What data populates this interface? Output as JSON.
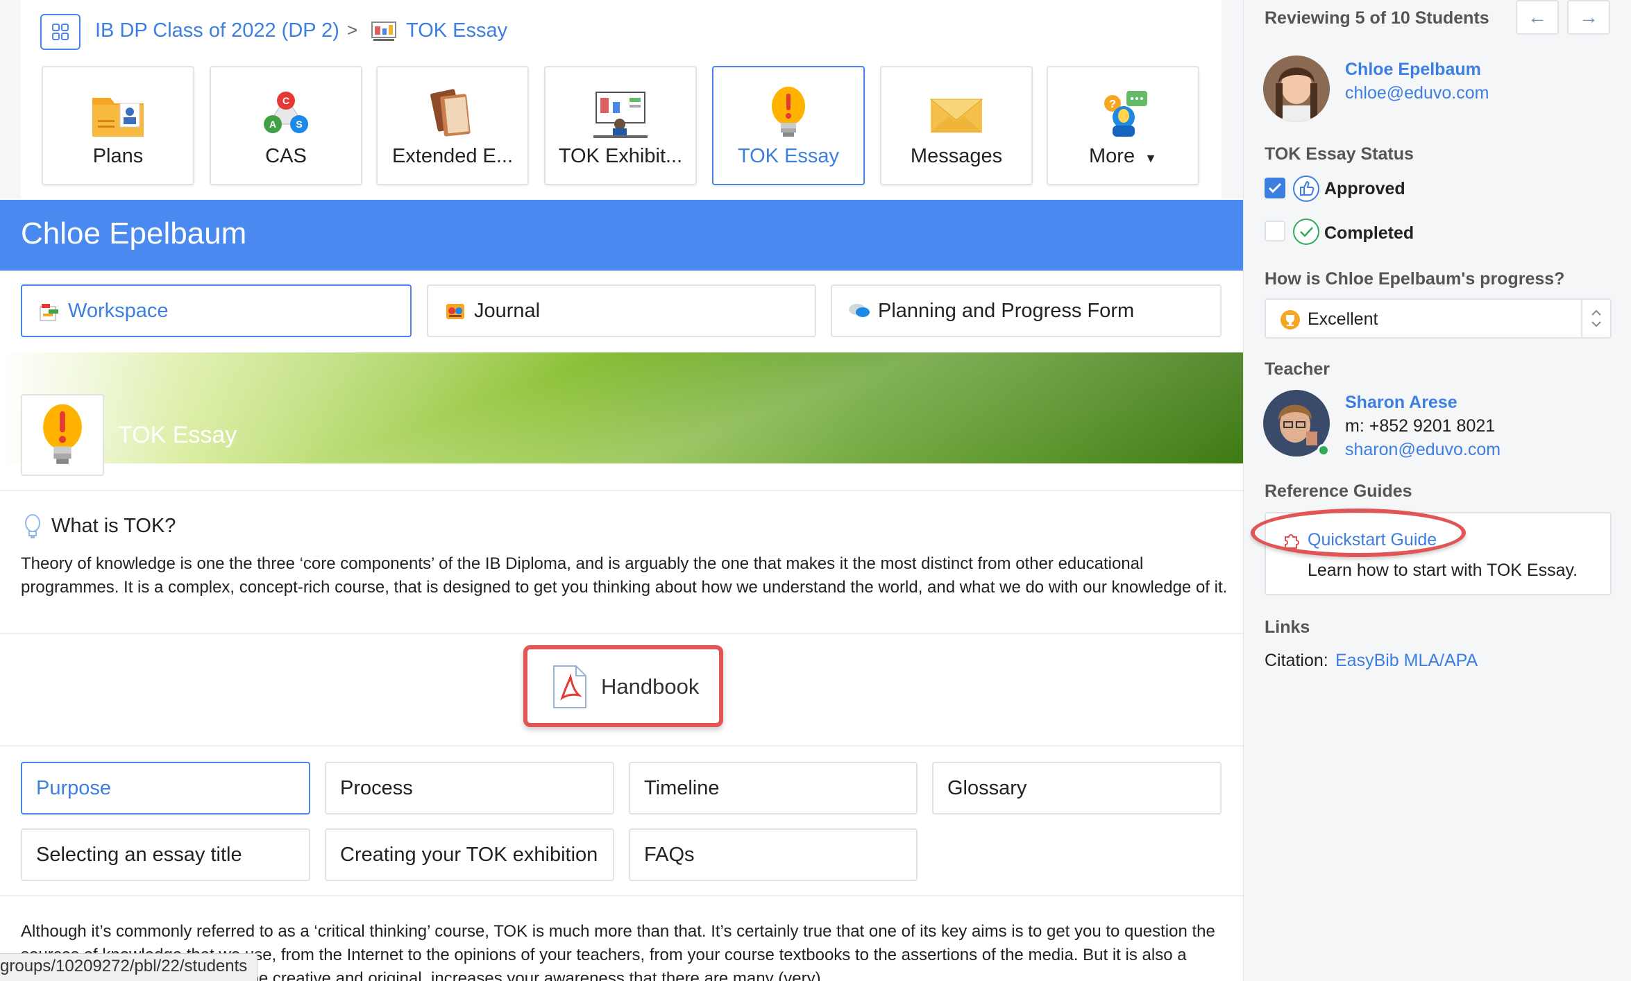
{
  "breadcrumb": {
    "class_name": "IB DP Class of 2022 (DP 2)",
    "separator": ">",
    "current": "TOK Essay"
  },
  "nav_cards": [
    {
      "label": "Plans",
      "icon": "folder-user-icon"
    },
    {
      "label": "CAS",
      "icon": "cas-molecule-icon"
    },
    {
      "label": "Extended E...",
      "icon": "books-icon"
    },
    {
      "label": "TOK Exhibit...",
      "icon": "presentation-icon"
    },
    {
      "label": "TOK Essay",
      "icon": "lightbulb-exclamation-icon"
    },
    {
      "label": "Messages",
      "icon": "envelope-icon"
    },
    {
      "label": "More",
      "icon": "chat-people-icon"
    }
  ],
  "student_name": "Chloe Epelbaum",
  "sub_tabs": [
    {
      "label": "Workspace",
      "icon": "workspace-icon"
    },
    {
      "label": "Journal",
      "icon": "journal-icon"
    },
    {
      "label": "Planning and Progress Form",
      "icon": "chat-bubbles-icon"
    }
  ],
  "banner_title": "TOK Essay",
  "what_is": {
    "title": "What is TOK?",
    "body": "Theory of knowledge is one the three ‘core components’ of the IB Diploma, and is arguably the one that makes it the most distinct from other educational programmes. It is a complex, concept-rich course, that is designed to get you thinking about how we understand the world, and what we do with our knowledge of it."
  },
  "handbook_label": "Handbook",
  "section_tabs": [
    {
      "label": "Purpose"
    },
    {
      "label": "Process"
    },
    {
      "label": "Timeline"
    },
    {
      "label": "Glossary"
    },
    {
      "label": "Selecting an essay title"
    },
    {
      "label": "Creating your TOK exhibition"
    },
    {
      "label": "FAQs"
    }
  ],
  "bottom_paragraph": "Although it’s commonly referred to as a ‘critical thinking’ course, TOK is much more than that. It’s certainly true that one of its key aims is to get you to question the sources of knowledge that we use, from the Internet to the opinions of your teachers, from your course textbooks to the assertions of the media. But it is also a course that encourages you to be creative and original, increases your awareness that there are many (very)",
  "status_url": "groups/10209272/pbl/22/students",
  "sidebar": {
    "reviewing": "Reviewing 5 of 10 Students",
    "student": {
      "name": "Chloe Epelbaum",
      "email": "chloe@eduvo.com"
    },
    "status_label": "TOK Essay Status",
    "statuses": [
      {
        "label": "Approved",
        "checked": true
      },
      {
        "label": "Completed",
        "checked": false
      }
    ],
    "progress_question": "How is Chloe Epelbaum's progress?",
    "progress_value": "Excellent",
    "teacher_label": "Teacher",
    "teacher": {
      "name": "Sharon Arese",
      "phone": "m: +852 9201 8021",
      "email": "sharon@eduvo.com"
    },
    "ref_label": "Reference Guides",
    "ref_guide": {
      "title": "Quickstart Guide",
      "desc": "Learn how to start with TOK Essay."
    },
    "links_label": "Links",
    "citation_prefix": "Citation:",
    "citation_link": "EasyBib MLA/APA"
  },
  "colors": {
    "accent": "#4a8af0",
    "link": "#3d7fe0",
    "highlight": "#e05555",
    "banner": "#5a9a20"
  }
}
